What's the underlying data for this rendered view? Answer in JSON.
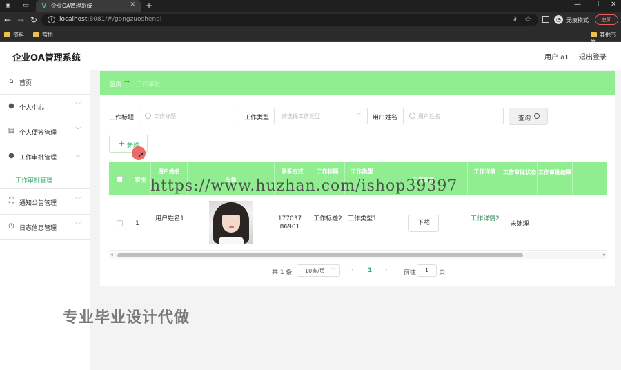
{
  "browser": {
    "tab_title": "企业OA管理系统",
    "url_host": "localhost",
    "url_port": ":8081",
    "url_path": "/#/gongzuoshenpi",
    "incognito_label": "无痕模式",
    "update_label": "更新",
    "bookmarks": [
      "资料",
      "常用"
    ],
    "bookmarks_right": "其他书签"
  },
  "app": {
    "title": "企业OA管理系统",
    "user_label": "用户 a1",
    "logout_label": "退出登录"
  },
  "sidebar": {
    "items": [
      {
        "label": "首页",
        "icon": "home-icon"
      },
      {
        "label": "个人中心",
        "icon": "user-icon"
      },
      {
        "label": "个人便签管理",
        "icon": "note-icon"
      },
      {
        "label": "工作审批管理",
        "icon": "user-icon"
      },
      {
        "label": "通知公告管理",
        "icon": "notice-icon"
      },
      {
        "label": "日志信息管理",
        "icon": "clock-icon"
      }
    ],
    "active_sub": "工作审批管理"
  },
  "breadcrumb": {
    "home": "首页",
    "current": "工作审批"
  },
  "search": {
    "title_label": "工作标题",
    "title_placeholder": "工作标题",
    "type_label": "工作类型",
    "type_placeholder": "请选择工作类型",
    "user_label": "用户姓名",
    "user_placeholder": "用户姓名",
    "query_label": "查询"
  },
  "actions": {
    "add_label": "新增"
  },
  "table": {
    "columns": [
      "索引",
      "用户姓名",
      "头像",
      "联系方式",
      "工作标题",
      "工作类型",
      "工作文件",
      "工作详情",
      "工作审批状态",
      "工作审批结果"
    ],
    "rows": [
      {
        "index": "1",
        "user_name": "用户姓名1",
        "phone": "17703786901",
        "title": "工作标题2",
        "type": "工作类型1",
        "file_action": "下载",
        "detail": "工作详情2",
        "status": "未处理",
        "result": ""
      }
    ]
  },
  "pagination": {
    "total": "共 1 条",
    "page_size": "10条/页",
    "current_page": "1",
    "goto_label": "前往",
    "goto_value": "1",
    "page_suffix": "页"
  },
  "watermarks": {
    "url": "https://www.huzhan.com/ishop39397",
    "text": "专业毕业设计代做"
  },
  "colors": {
    "accent": "#90ee90",
    "link": "#2e8b57",
    "cursor": "#e85050"
  }
}
